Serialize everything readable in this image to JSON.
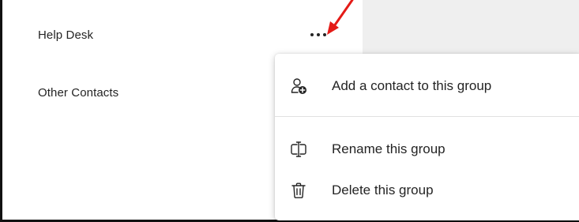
{
  "contact_groups": [
    {
      "label": "Help Desk"
    },
    {
      "label": "Other Contacts"
    }
  ],
  "more_options": {
    "icon": "more-horizontal-icon",
    "glyph": "..."
  },
  "context_menu": {
    "items": [
      {
        "label": "Add a contact to this group",
        "icon": "add-person-icon"
      },
      {
        "label": "Rename this group",
        "icon": "rename-icon"
      },
      {
        "label": "Delete this group",
        "icon": "trash-icon"
      }
    ]
  },
  "colors": {
    "annotation_arrow": "#e41b17",
    "text": "#242424",
    "right_pane": "#efefef",
    "divider": "#e1e1e1"
  }
}
